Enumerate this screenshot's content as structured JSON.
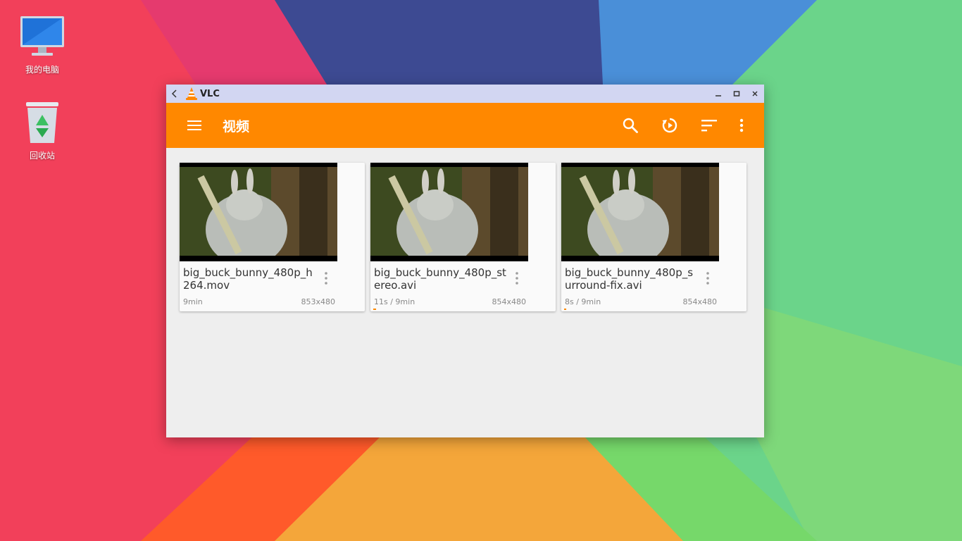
{
  "desktop": {
    "icons": [
      {
        "label": "我的电脑",
        "icon": "monitor-icon"
      },
      {
        "label": "回收站",
        "icon": "recycle-bin-icon"
      }
    ]
  },
  "window": {
    "app_name": "VLC",
    "controls": [
      "minimize-icon",
      "maximize-icon",
      "close-icon"
    ]
  },
  "toolbar": {
    "title": "视频",
    "accent_color": "#ff8800",
    "actions": [
      "search-icon",
      "resume-playback-icon",
      "sort-icon",
      "more-vert-icon"
    ]
  },
  "videos": [
    {
      "name": "big_buck_bunny_480p_h264.mov",
      "duration": "9min",
      "resolution": "853x480",
      "progress": 0
    },
    {
      "name": "big_buck_bunny_480p_stereo.avi",
      "duration": "11s / 9min",
      "resolution": "854x480",
      "progress": 0.02
    },
    {
      "name": "big_buck_bunny_480p_surround-fix.avi",
      "duration": "8s / 9min",
      "resolution": "854x480",
      "progress": 0.015
    }
  ]
}
